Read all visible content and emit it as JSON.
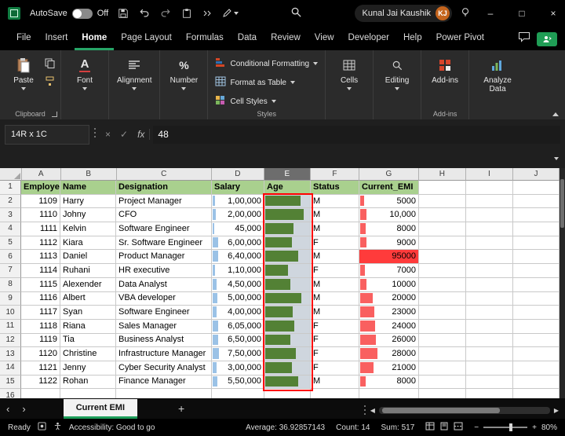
{
  "title_bar": {
    "autosave_label": "AutoSave",
    "autosave_state": "Off",
    "account_name": "Kunal Jai Kaushik",
    "avatar_initials": "KJ"
  },
  "menu": {
    "tabs": [
      "File",
      "Insert",
      "Home",
      "Page Layout",
      "Formulas",
      "Data",
      "Review",
      "View",
      "Developer",
      "Help",
      "Power Pivot"
    ],
    "active": "Home"
  },
  "ribbon": {
    "paste_label": "Paste",
    "clipboard_group_label": "Clipboard",
    "font_label": "Font",
    "alignment_label": "Alignment",
    "number_label": "Number",
    "conditional_formatting_label": "Conditional Formatting",
    "format_as_table_label": "Format as Table",
    "cell_styles_label": "Cell Styles",
    "styles_group_label": "Styles",
    "cells_label": "Cells",
    "editing_label": "Editing",
    "addins_label": "Add-ins",
    "addins_group_label": "Add-ins",
    "analyze_data_label": "Analyze Data"
  },
  "formula_bar": {
    "name_box": "14R x 1C",
    "fx_label": "fx",
    "value": "48"
  },
  "grid": {
    "column_letters": [
      "A",
      "B",
      "C",
      "D",
      "E",
      "F",
      "G",
      "H",
      "I",
      "J"
    ],
    "selected_column": "E",
    "selection": "E2:E15",
    "header_row": [
      "Employee",
      "Name",
      "Designation",
      "Salary",
      "Age",
      "Status",
      "Current_EMI"
    ],
    "rows": [
      {
        "employee": "1109",
        "name": "Harry",
        "designation": "Project Manager",
        "salary": "1,00,000",
        "salary_bar": 0.05,
        "age_bar": 0.78,
        "status": "M",
        "emi": "5000",
        "emi_bar": 0.06,
        "emi_full": false
      },
      {
        "employee": "1110",
        "name": "Johny",
        "designation": "CFO",
        "salary": "2,00,000",
        "salary_bar": 0.06,
        "age_bar": 0.85,
        "status": "M",
        "emi": "10,000",
        "emi_bar": 0.11,
        "emi_full": false
      },
      {
        "employee": "1111",
        "name": "Kelvin",
        "designation": "Software Engineer",
        "salary": "45,000",
        "salary_bar": 0.03,
        "age_bar": 0.62,
        "status": "M",
        "emi": "8000",
        "emi_bar": 0.09,
        "emi_full": false
      },
      {
        "employee": "1112",
        "name": "Kiara",
        "designation": "Sr. Software Engineer",
        "salary": "6,00,000",
        "salary_bar": 0.1,
        "age_bar": 0.58,
        "status": "F",
        "emi": "9000",
        "emi_bar": 0.1,
        "emi_full": false
      },
      {
        "employee": "1113",
        "name": "Daniel",
        "designation": "Product Manager",
        "salary": "6,40,000",
        "salary_bar": 0.11,
        "age_bar": 0.72,
        "status": "M",
        "emi": "95000",
        "emi_bar": 1.0,
        "emi_full": true
      },
      {
        "employee": "1114",
        "name": "Ruhani",
        "designation": "HR executive",
        "salary": "1,10,000",
        "salary_bar": 0.05,
        "age_bar": 0.5,
        "status": "F",
        "emi": "7000",
        "emi_bar": 0.08,
        "emi_full": false
      },
      {
        "employee": "1115",
        "name": "Alexender",
        "designation": "Data Analyst",
        "salary": "4,50,000",
        "salary_bar": 0.08,
        "age_bar": 0.55,
        "status": "M",
        "emi": "10000",
        "emi_bar": 0.11,
        "emi_full": false
      },
      {
        "employee": "1116",
        "name": "Albert",
        "designation": "VBA developer",
        "salary": "5,00,000",
        "salary_bar": 0.09,
        "age_bar": 0.8,
        "status": "M",
        "emi": "20000",
        "emi_bar": 0.21,
        "emi_full": false
      },
      {
        "employee": "1117",
        "name": "Syan",
        "designation": "Software Engineer",
        "salary": "4,00,000",
        "salary_bar": 0.08,
        "age_bar": 0.6,
        "status": "M",
        "emi": "23000",
        "emi_bar": 0.24,
        "emi_full": false
      },
      {
        "employee": "1118",
        "name": "Riana",
        "designation": "Sales Manager",
        "salary": "6,05,000",
        "salary_bar": 0.1,
        "age_bar": 0.64,
        "status": "F",
        "emi": "24000",
        "emi_bar": 0.25,
        "emi_full": false
      },
      {
        "employee": "1119",
        "name": "Tia",
        "designation": "Business Analyst",
        "salary": "6,50,000",
        "salary_bar": 0.11,
        "age_bar": 0.55,
        "status": "F",
        "emi": "26000",
        "emi_bar": 0.27,
        "emi_full": false
      },
      {
        "employee": "1120",
        "name": "Christine",
        "designation": "Infrastructure Manager",
        "salary": "7,50,000",
        "salary_bar": 0.12,
        "age_bar": 0.68,
        "status": "F",
        "emi": "28000",
        "emi_bar": 0.29,
        "emi_full": false
      },
      {
        "employee": "1121",
        "name": "Jenny",
        "designation": "Cyber Security Analyst",
        "salary": "3,00,000",
        "salary_bar": 0.07,
        "age_bar": 0.58,
        "status": "F",
        "emi": "21000",
        "emi_bar": 0.22,
        "emi_full": false
      },
      {
        "employee": "1122",
        "name": "Rohan",
        "designation": "Finance Manager",
        "salary": "5,50,000",
        "salary_bar": 0.09,
        "age_bar": 0.72,
        "status": "M",
        "emi": "8000",
        "emi_bar": 0.09,
        "emi_full": false
      }
    ]
  },
  "sheet_tabs": {
    "active_tab": "Current EMI"
  },
  "status_bar": {
    "mode": "Ready",
    "accessibility": "Accessibility: Good to go",
    "average": "Average: 36.92857143",
    "count": "Count: 14",
    "sum": "Sum: 517",
    "zoom": "80%"
  },
  "colors": {
    "accent_green": "#27a567",
    "header_fill": "#a9d08e",
    "age_bar_green": "#538135",
    "salary_bar_blue": "#9bc2e6",
    "emi_bar_red": "#f96060",
    "emi_alert_fill": "#ff3b3b",
    "selection_box_red": "#ff0000"
  }
}
